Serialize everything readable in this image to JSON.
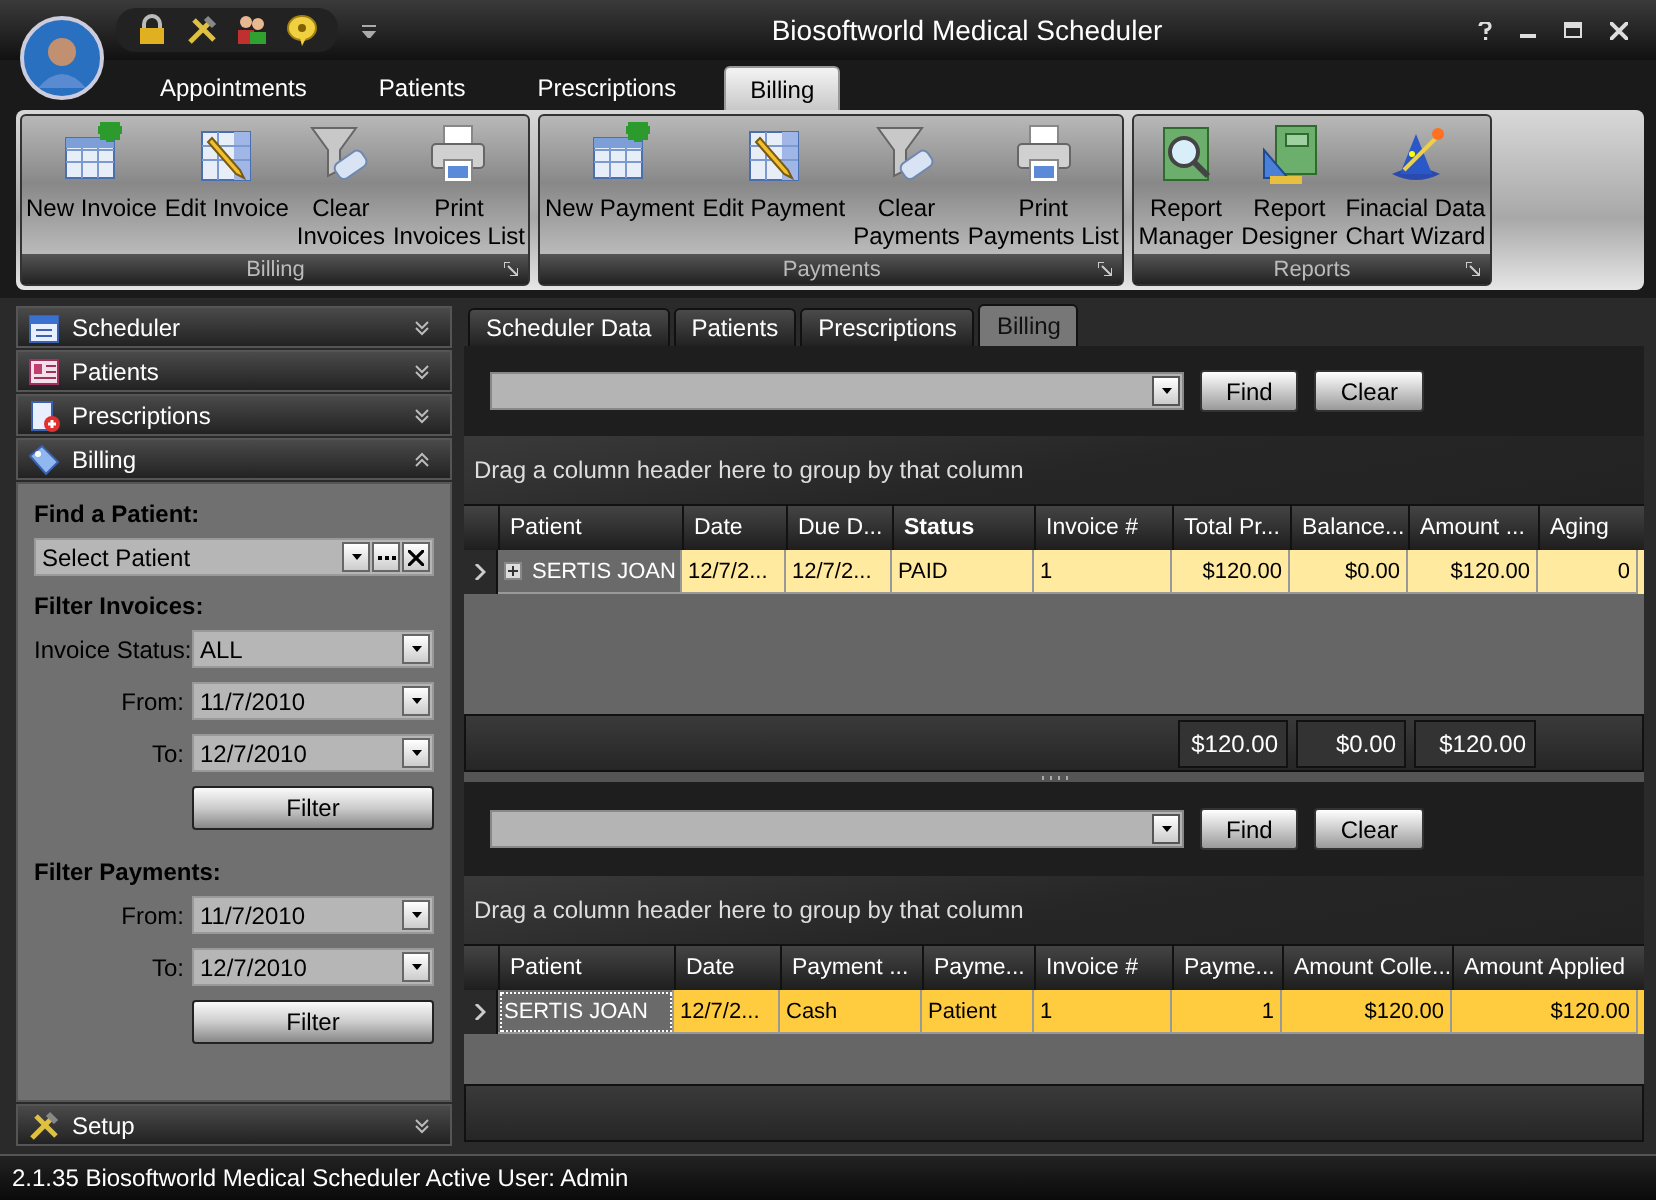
{
  "window": {
    "title": "Biosoftworld Medical Scheduler"
  },
  "ribbon": {
    "tabs": [
      {
        "label": "Appointments",
        "selected": false
      },
      {
        "label": "Patients",
        "selected": false
      },
      {
        "label": "Prescriptions",
        "selected": false
      },
      {
        "label": "Billing",
        "selected": true
      }
    ],
    "groups": [
      {
        "title": "Billing",
        "buttons": [
          {
            "lines": [
              "New Invoice"
            ],
            "kind": "add"
          },
          {
            "lines": [
              "Edit Invoice"
            ],
            "kind": "edit"
          },
          {
            "lines": [
              "Clear",
              "Invoices"
            ],
            "kind": "clear"
          },
          {
            "lines": [
              "Print",
              "Invoices List"
            ],
            "kind": "print"
          }
        ]
      },
      {
        "title": "Payments",
        "buttons": [
          {
            "lines": [
              "New Payment"
            ],
            "kind": "add"
          },
          {
            "lines": [
              "Edit Payment"
            ],
            "kind": "edit"
          },
          {
            "lines": [
              "Clear",
              "Payments"
            ],
            "kind": "clear"
          },
          {
            "lines": [
              "Print",
              "Payments List"
            ],
            "kind": "print"
          }
        ]
      },
      {
        "title": "Reports",
        "buttons": [
          {
            "lines": [
              "Report",
              "Manager"
            ],
            "kind": "manager"
          },
          {
            "lines": [
              "Report",
              "Designer"
            ],
            "kind": "designer"
          },
          {
            "lines": [
              "Finacial Data",
              "Chart Wizard"
            ],
            "kind": "wizard"
          }
        ]
      }
    ]
  },
  "nav": {
    "items": [
      {
        "label": "Scheduler",
        "kind": "scheduler",
        "expanded": false
      },
      {
        "label": "Patients",
        "kind": "patients",
        "expanded": false
      },
      {
        "label": "Prescriptions",
        "kind": "prescriptions",
        "expanded": false
      },
      {
        "label": "Billing",
        "kind": "billing",
        "expanded": true
      },
      {
        "label": "Setup",
        "kind": "setup",
        "expanded": false
      }
    ],
    "panel": {
      "find_patient": {
        "heading": "Find a Patient:",
        "value": "Select Patient"
      },
      "filter_invoices": {
        "heading": "Filter Invoices:",
        "fields": [
          {
            "label": "Invoice Status:",
            "value": "ALL"
          },
          {
            "label": "From:",
            "value": "11/7/2010"
          },
          {
            "label": "To:",
            "value": "12/7/2010"
          }
        ],
        "button": "Filter"
      },
      "filter_payments": {
        "heading": "Filter Payments:",
        "fields": [
          {
            "label": "From:",
            "value": "11/7/2010"
          },
          {
            "label": "To:",
            "value": "12/7/2010"
          }
        ],
        "button": "Filter"
      }
    }
  },
  "content_tabs": [
    {
      "label": "Scheduler Data",
      "selected": false
    },
    {
      "label": "Patients",
      "selected": false
    },
    {
      "label": "Prescriptions",
      "selected": false
    },
    {
      "label": "Billing",
      "selected": true
    }
  ],
  "invoices": {
    "find_button": "Find",
    "clear_button": "Clear",
    "group_hint": "Drag a column header here to group by that column",
    "columns": [
      {
        "label": "Patient",
        "bold": false
      },
      {
        "label": "Date",
        "bold": false
      },
      {
        "label": "Due D...",
        "bold": false
      },
      {
        "label": "Status",
        "bold": true
      },
      {
        "label": "Invoice #",
        "bold": false
      },
      {
        "label": "Total Pr...",
        "bold": false,
        "total": "$120.00"
      },
      {
        "label": "Balance...",
        "bold": false,
        "total": "$0.00"
      },
      {
        "label": "Amount ...",
        "bold": false,
        "total": "$120.00"
      },
      {
        "label": "Aging",
        "bold": false
      }
    ],
    "rows": [
      {
        "selected": false,
        "expandable": true,
        "focused": false,
        "cells": [
          "SERTIS JOAN",
          "12/7/2...",
          "12/7/2...",
          "PAID",
          "1",
          "$120.00",
          "$0.00",
          "$120.00",
          "0"
        ]
      }
    ]
  },
  "payments": {
    "find_button": "Find",
    "clear_button": "Clear",
    "group_hint": "Drag a column header here to group by that column",
    "columns": [
      {
        "label": "Patient",
        "bold": false
      },
      {
        "label": "Date",
        "bold": false
      },
      {
        "label": "Payment ...",
        "bold": false
      },
      {
        "label": "Payme...",
        "bold": false
      },
      {
        "label": "Invoice #",
        "bold": false
      },
      {
        "label": "Payme...",
        "bold": false
      },
      {
        "label": "Amount Colle...",
        "bold": false
      },
      {
        "label": "Amount Applied",
        "bold": false
      }
    ],
    "rows": [
      {
        "selected": true,
        "expandable": false,
        "focused": true,
        "cells": [
          "SERTIS JOAN",
          "12/7/2...",
          "Cash",
          "Patient",
          "1",
          "1",
          "$120.00",
          "$120.00"
        ]
      }
    ]
  },
  "status_bar": {
    "text": "2.1.35 Biosoftworld Medical Scheduler Active User: Admin"
  }
}
